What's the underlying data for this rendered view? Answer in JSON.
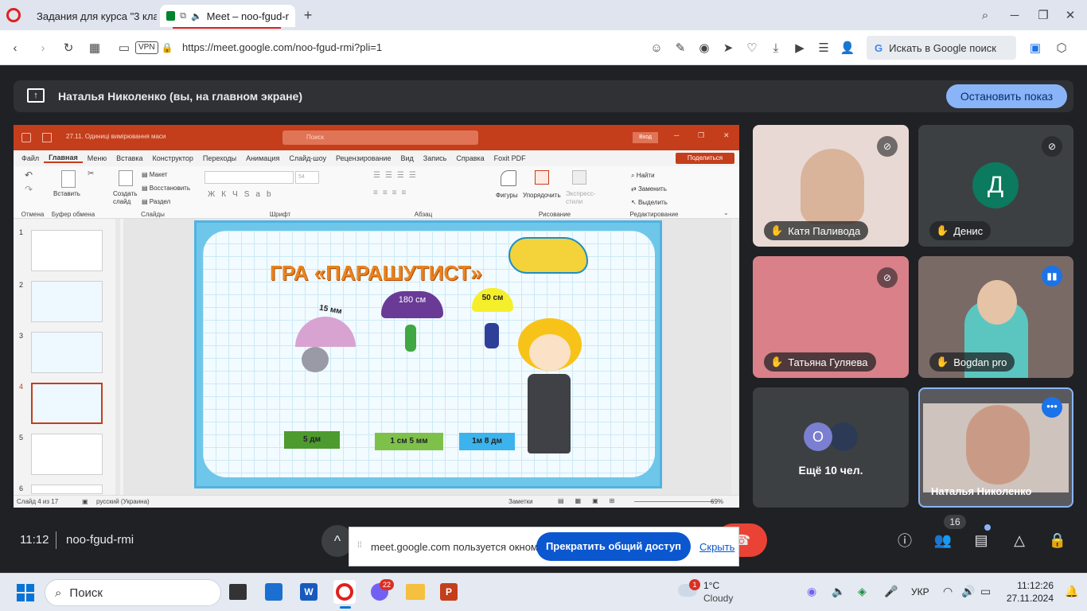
{
  "browser": {
    "tabs": [
      {
        "title": "Задания для курса \"3 кла"
      },
      {
        "title": "Meet – noo-fgud-r"
      }
    ],
    "address": "https://meet.google.com/noo-fgud-rmi?pli=1",
    "vpn": "VPN",
    "search_placeholder": "Искать в Google поиск"
  },
  "meet": {
    "presenting_text": "Наталья Николенко (вы, на главном экране)",
    "stop_button": "Остановить показ",
    "time": "11:12",
    "meeting_code": "noo-fgud-rmi",
    "people_count": "16",
    "share_notice": "meet.google.com пользуется окном.",
    "stop_sharing": "Прекратить общий доступ",
    "hide": "Скрыть",
    "participants": [
      {
        "name": "Катя Паливода",
        "muted": true
      },
      {
        "name": "Денис",
        "muted": true,
        "avatar_letter": "Д",
        "avatar_color": "#0b7a5e"
      },
      {
        "name": "Татьяна Гуляева",
        "muted": true
      },
      {
        "name": "Bogdan pro",
        "muted": false
      },
      {
        "name": "Ещё 10 чел.",
        "avatar_letter": "О"
      },
      {
        "name": "Наталья Николенко"
      }
    ]
  },
  "ppt": {
    "title": "27.11. Одиниці вимірювання маси",
    "search": "Поиск",
    "login": "Вход",
    "tabs": [
      "Файл",
      "Главная",
      "Меню",
      "Вставка",
      "Конструктор",
      "Переходы",
      "Анимация",
      "Слайд-шоу",
      "Рецензирование",
      "Вид",
      "Запись",
      "Справка",
      "Foxit PDF"
    ],
    "share": "Поделиться",
    "groups": [
      "Отмена",
      "Буфер обмена",
      "Слайды",
      "Шрифт",
      "Абзац",
      "Рисование",
      "Редактирование"
    ],
    "buttons": {
      "paste": "Вставить",
      "new_slide": "Создать слайд",
      "layout": "Макет",
      "reset": "Восстановить",
      "section": "Раздел",
      "shapes": "Фигуры",
      "arrange": "Упорядочить",
      "quick_styles": "Экспресс-стили",
      "find": "Найти",
      "replace": "Заменить",
      "select": "Выделить"
    },
    "thumbnails": [
      "1",
      "2",
      "3",
      "4",
      "5",
      "6"
    ],
    "slide": {
      "title": "ГРА «ПАРАШУТИСТ»",
      "labels": [
        "15 мм",
        "180 см",
        "50 см"
      ],
      "answers": [
        "5 дм",
        "1 см 5 мм",
        "1м 8 дм"
      ]
    },
    "status": {
      "slide": "Слайд 4 из 17",
      "lang": "русский (Украина)",
      "notes": "Заметки",
      "zoom": "69%"
    }
  },
  "taskbar": {
    "search": "Поиск",
    "viber_badge": "22",
    "weather_badge": "1",
    "temp": "1°C",
    "weather": "Cloudy",
    "lang": "УКР",
    "time": "11:12:26",
    "date": "27.11.2024"
  },
  "colors": {
    "meet_bg": "#202124",
    "blue_button": "#8ab4f8",
    "ppt_red": "#c43e1c",
    "stop_share": "#0b57d0"
  }
}
